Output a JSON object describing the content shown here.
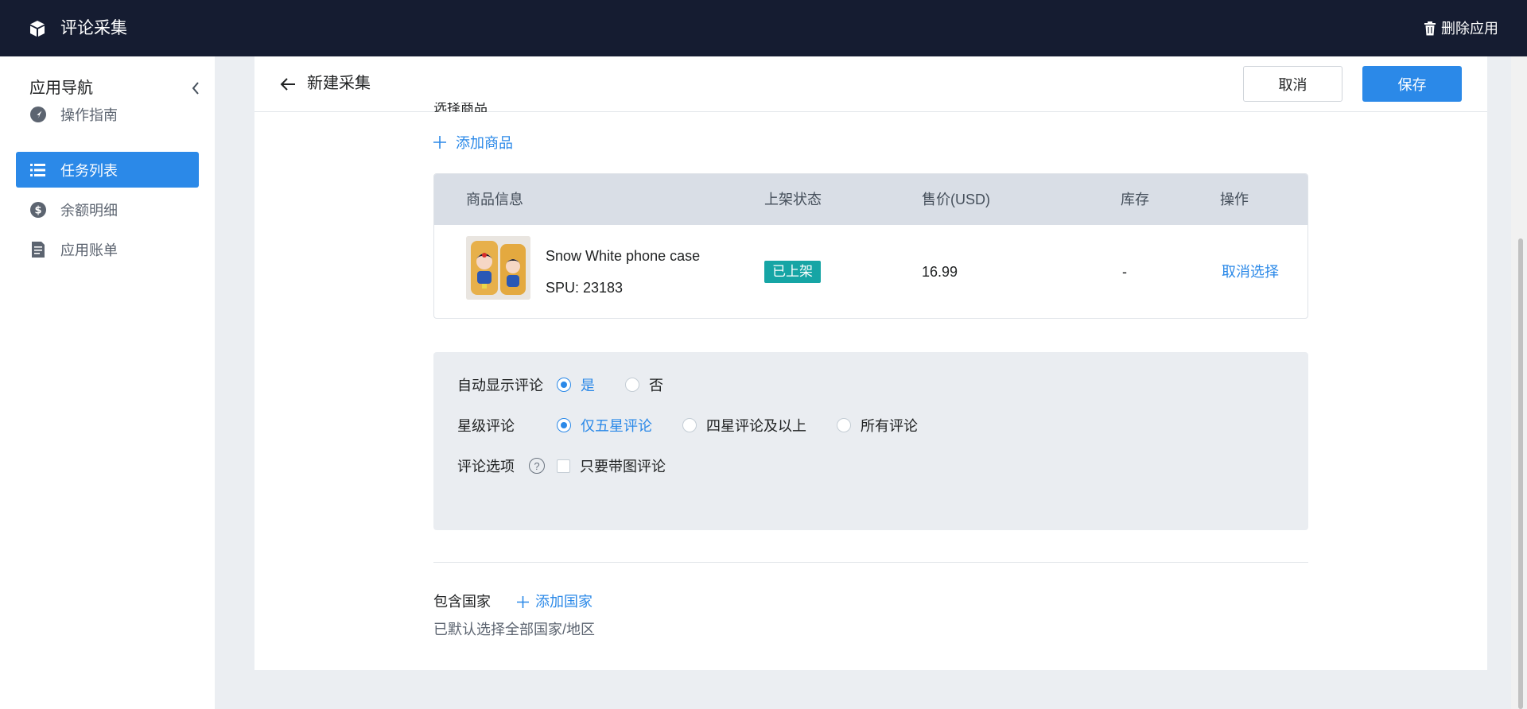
{
  "topbar": {
    "app_title": "评论采集",
    "delete_label": "删除应用",
    "logo_icon": "cube-icon",
    "delete_icon": "trash-icon"
  },
  "sidebar": {
    "title": "应用导航",
    "items": [
      {
        "label": "操作指南",
        "icon": "navigation-arrow-icon",
        "active": false
      },
      {
        "label": "任务列表",
        "icon": "list-icon",
        "active": true
      },
      {
        "label": "余额明细",
        "icon": "dollar-icon",
        "active": false
      },
      {
        "label": "应用账单",
        "icon": "document-icon",
        "active": false
      }
    ]
  },
  "header": {
    "title": "新建采集",
    "cancel_label": "取消",
    "save_label": "保存"
  },
  "products": {
    "section_label": "选择商品",
    "add_label": "添加商品",
    "columns": [
      "商品信息",
      "上架状态",
      "售价(USD)",
      "库存",
      "操作"
    ],
    "rows": [
      {
        "name": "Snow White phone case",
        "spu": "SPU: 23183",
        "status": "已上架",
        "price": "16.99",
        "stock": "-",
        "action": "取消选择"
      }
    ]
  },
  "options": {
    "auto_display": {
      "label": "自动显示评论",
      "choices": [
        "是",
        "否"
      ],
      "selected": "是"
    },
    "star_rating": {
      "label": "星级评论",
      "choices": [
        "仅五星评论",
        "四星评论及以上",
        "所有评论"
      ],
      "selected": "仅五星评论"
    },
    "review_options": {
      "label": "评论选项",
      "help": "?",
      "checkbox_label": "只要带图评论",
      "checked": false
    }
  },
  "countries": {
    "label": "包含国家",
    "add_label": "添加国家",
    "note": "已默认选择全部国家/地区"
  },
  "colors": {
    "accent": "#2b89e8",
    "topbar": "#151c31",
    "status_badge": "#16a5a5"
  }
}
